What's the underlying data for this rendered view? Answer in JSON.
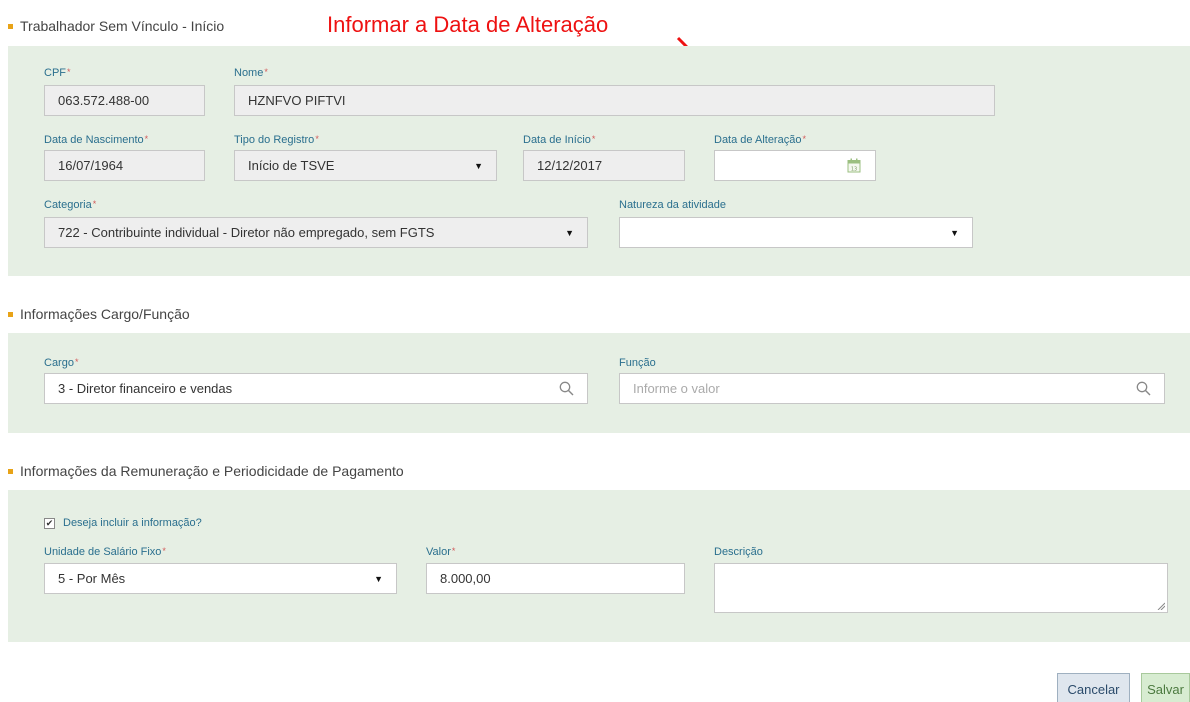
{
  "annotation": {
    "text": "Informar a Data de Alteração",
    "color": "#ee1111"
  },
  "sections": {
    "worker": {
      "title": "Trabalhador Sem Vínculo - Início"
    },
    "cargo": {
      "title": "Informações Cargo/Função"
    },
    "remun": {
      "title": "Informações da Remuneração e Periodicidade de Pagamento"
    }
  },
  "fields": {
    "cpf": {
      "label": "CPF",
      "value": "063.572.488-00"
    },
    "nome": {
      "label": "Nome",
      "value": "HZNFVO PIFTVI"
    },
    "data_nascimento": {
      "label": "Data de Nascimento",
      "value": "16/07/1964"
    },
    "tipo_registro": {
      "label": "Tipo do Registro",
      "value": "Início de TSVE"
    },
    "data_inicio": {
      "label": "Data de Início",
      "value": "12/12/2017"
    },
    "data_alteracao": {
      "label": "Data de Alteração",
      "value": ""
    },
    "categoria": {
      "label": "Categoria",
      "value": "722 - Contribuinte individual - Diretor não empregado, sem FGTS"
    },
    "natureza": {
      "label": "Natureza da atividade",
      "value": ""
    },
    "cargo": {
      "label": "Cargo",
      "value": "3 - Diretor financeiro e vendas"
    },
    "funcao": {
      "label": "Função",
      "value": "",
      "placeholder": "Informe o valor"
    },
    "incluir": {
      "label": "Deseja incluir a informação?",
      "checked": true
    },
    "unidade": {
      "label": "Unidade de Salário Fixo",
      "value": "5 - Por Mês"
    },
    "valor": {
      "label": "Valor",
      "value": "8.000,00"
    },
    "descricao": {
      "label": "Descrição",
      "value": ""
    }
  },
  "required_mark": "*",
  "buttons": {
    "cancel": "Cancelar",
    "save": "Salvar"
  },
  "colors": {
    "panel": "#e6efe4",
    "label": "#2a6f8e",
    "bullet": "#e8a317",
    "required": "#d25a5a"
  }
}
